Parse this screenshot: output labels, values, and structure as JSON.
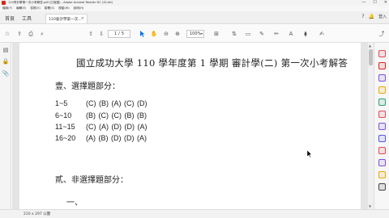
{
  "window": {
    "title": "110會計學第一次小考解答.pdf (已保護) - Adobe Acrobat Reader DC (32-bit)",
    "controls": [
      "—",
      "☐",
      "✕"
    ]
  },
  "menubar": [
    "檔案(F)",
    "編輯(E)",
    "檢視(V)",
    "簽署(S)",
    "視窗(W)",
    "說明(H)"
  ],
  "tabs": {
    "home": "首頁",
    "tools": "工具",
    "document": "110會計學第一次..."
  },
  "account": {
    "help": "?",
    "bell": "🔔",
    "sign_in": "登入"
  },
  "toolbar": {
    "page_current": "1",
    "page_sep": "/",
    "page_total": "5",
    "zoom": "100%"
  },
  "document": {
    "title": "國立成功大學 110 學年度第 1 學期  審計學(二)  第一次小考解答",
    "section1_heading": "壹、選擇題部分：",
    "answers": [
      {
        "range": "1~5",
        "letters": "(C) (B) (A) (C) (D)"
      },
      {
        "range": "6~10",
        "letters": "(B) (C) (C) (B) (B)"
      },
      {
        "range": "11~15",
        "letters": "(C) (A) (D) (D) (A)"
      },
      {
        "range": "16~20",
        "letters": "(A) (B) (D) (D) (A)"
      }
    ],
    "section2_heading": "貳、非選擇題部分：",
    "partial_line": "一、"
  },
  "status": {
    "dims": "210 x 297 公釐"
  },
  "colors": {
    "accent": "#1473e6",
    "brand": "#d7261b",
    "right_icons": [
      "#e34850",
      "#d7261b",
      "#7d52d6",
      "#e6a700",
      "#2d9d78",
      "#e34850",
      "#7d52d6",
      "#5258e4",
      "#e34850",
      "#7d52d6",
      "#e6a700",
      "#444444"
    ]
  }
}
